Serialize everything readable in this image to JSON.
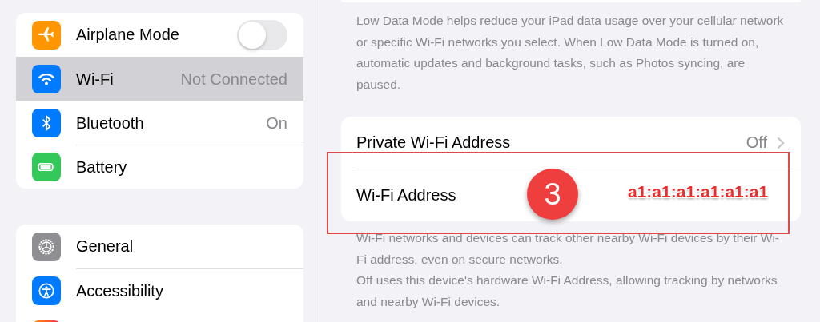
{
  "sidebar": {
    "groups": [
      {
        "items": [
          {
            "kind": "toggle",
            "label": "Airplane Mode",
            "on": false,
            "selected": false
          },
          {
            "kind": "value",
            "label": "Wi-Fi",
            "value": "Not Connected",
            "selected": true
          },
          {
            "kind": "value",
            "label": "Bluetooth",
            "value": "On",
            "selected": false
          },
          {
            "kind": "plain",
            "label": "Battery",
            "selected": false
          }
        ]
      },
      {
        "items": [
          {
            "kind": "plain",
            "label": "General",
            "selected": false
          },
          {
            "kind": "plain",
            "label": "Accessibility",
            "selected": false
          },
          {
            "kind": "partial"
          }
        ]
      }
    ]
  },
  "detail": {
    "low_data_footer": "Low Data Mode helps reduce your iPad data usage over your cellular network or specific Wi-Fi networks you select. When Low Data Mode is turned on, automatic updates and background tasks, such as Photos syncing, are paused.",
    "rows": [
      {
        "kind": "link",
        "label": "Private Wi-Fi Address",
        "value": "Off"
      },
      {
        "kind": "info",
        "label": "Wi-Fi Address"
      }
    ],
    "footer": [
      "Wi-Fi networks and devices can track other nearby Wi-Fi devices by their Wi-Fi address, even on secure networks.",
      "Off uses this device's hardware Wi-Fi Address, allowing tracking by networks and nearby Wi-Fi devices."
    ]
  },
  "annotation": {
    "step": "3",
    "address": "a1:a1:a1:a1:a1:a1"
  }
}
